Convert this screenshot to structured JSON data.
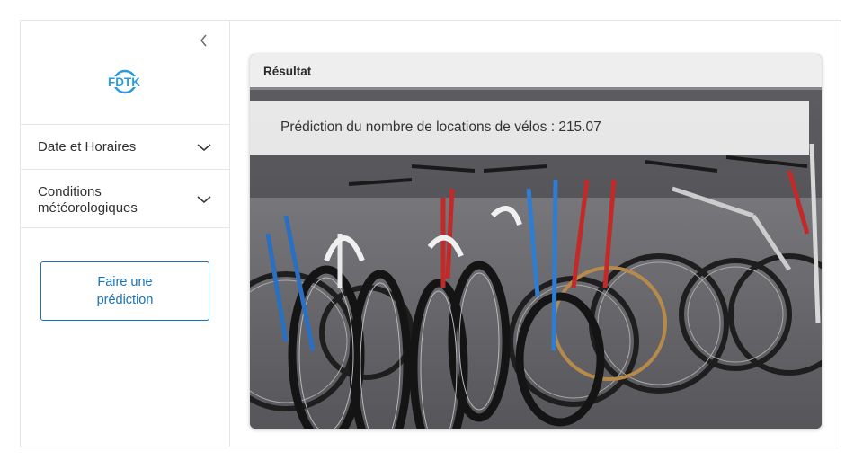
{
  "sidebar": {
    "logo_text": "FDTK",
    "sections": [
      {
        "label": "Date et Horaires"
      },
      {
        "label": "Conditions météorologiques"
      }
    ],
    "predict_button": "Faire une prédiction"
  },
  "result": {
    "title": "Résultat",
    "text": "Prédiction du nombre de locations de vélos : 215.07"
  },
  "colors": {
    "accent": "#1a73b8",
    "logo": "#2b9be0",
    "border": "#e6e6e6"
  }
}
